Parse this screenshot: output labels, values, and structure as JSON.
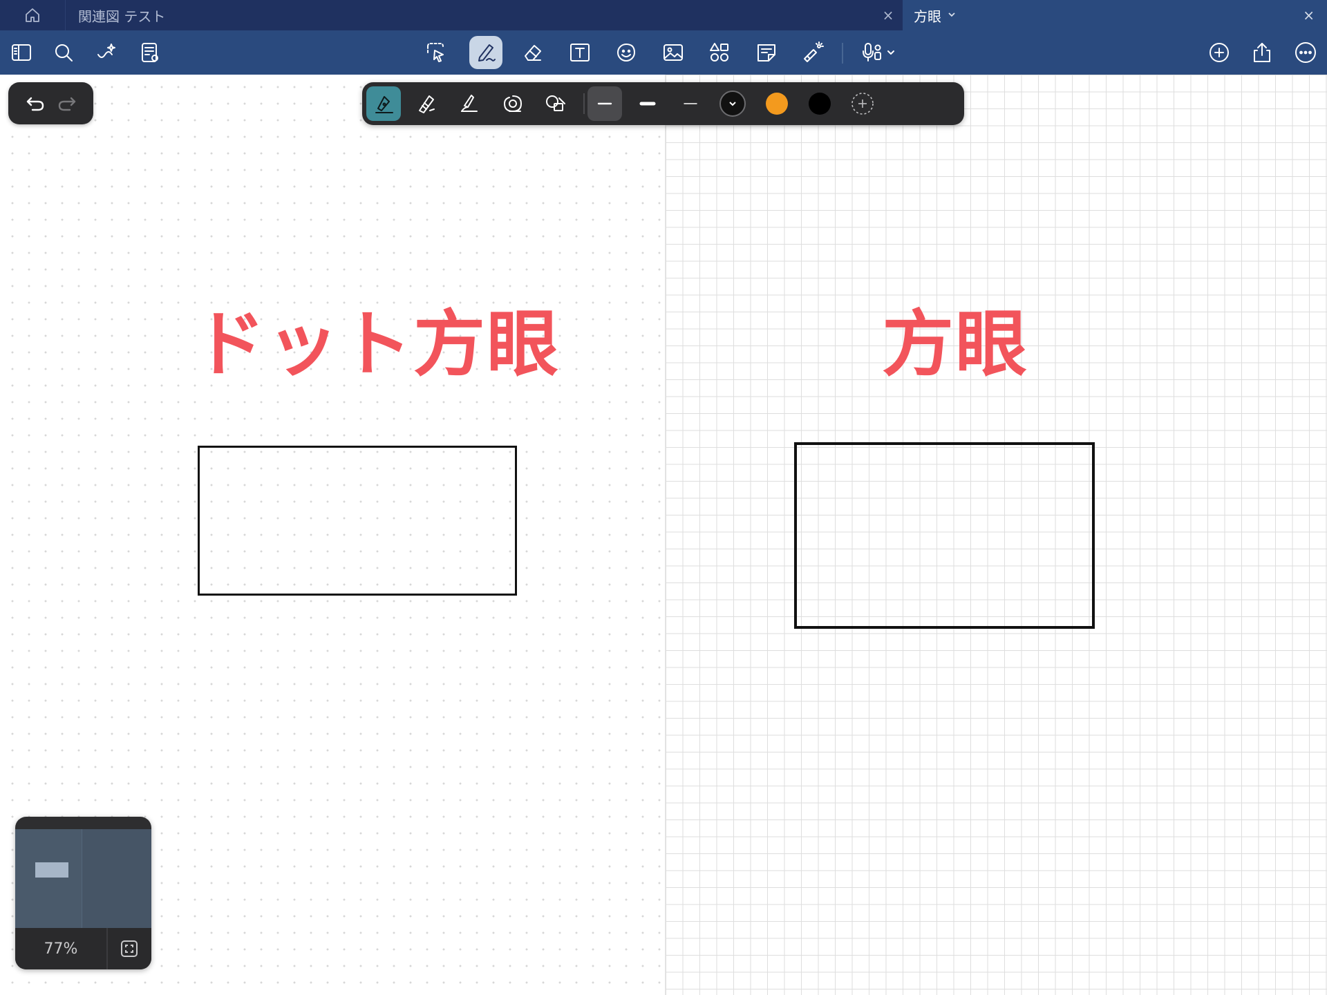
{
  "tabbar": {
    "home_icon": "home-icon",
    "tabs": [
      {
        "title": "関連図 テスト",
        "close": "×",
        "active": false
      },
      {
        "title": "方眼",
        "chevron": "⌄",
        "close": "×",
        "active": true
      }
    ]
  },
  "toolbar": {
    "left_icons": [
      "sidebar-icon",
      "search-icon",
      "ai-sparkle-icon",
      "page-settings-icon"
    ],
    "center_icons": [
      "lasso-icon",
      "pen-icon",
      "eraser-icon",
      "text-icon",
      "sticker-icon",
      "image-icon",
      "shapes-icon",
      "sticky-note-icon",
      "laser-pointer-icon",
      "mic-icon"
    ],
    "active_tool": "pen-icon",
    "right_icons": [
      "add-icon",
      "share-icon",
      "more-icon"
    ]
  },
  "canvas": {
    "left_heading": "ドット方眼",
    "right_heading": "方眼",
    "heading_color": "#f2545b"
  },
  "pen_panel": {
    "pen_types": [
      "fountain-pen-icon",
      "ball-pen-icon",
      "brush-pen-icon",
      "spiral-pen-icon",
      "shape-pen-icon"
    ],
    "active_pen": "fountain-pen-icon",
    "widths": [
      "medium",
      "thick",
      "thin"
    ],
    "active_width": "medium",
    "colors": [
      "#111111",
      "#f39a1e",
      "#000000"
    ],
    "selected_color": "#111111"
  },
  "navigator": {
    "zoom": "77%"
  }
}
